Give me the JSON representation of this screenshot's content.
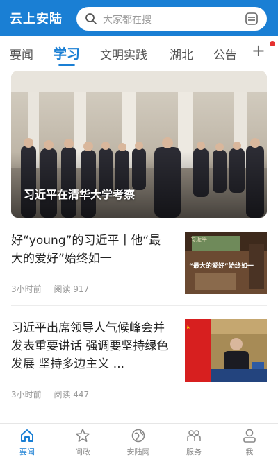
{
  "header": {
    "app_title": "云上安陆",
    "search_placeholder": "大家都在搜"
  },
  "tabs": [
    {
      "label": "要闻"
    },
    {
      "label": "学习"
    },
    {
      "label": "文明实践"
    },
    {
      "label": "湖北"
    },
    {
      "label": "公告"
    }
  ],
  "feature": {
    "title": "习近平在清华大学考察"
  },
  "news": [
    {
      "title": "好“young”的习近平丨他“最大的爱好”始终如一",
      "time": "3小时前",
      "reads": "阅读 917",
      "thumb_text": "“最大的爱好”始终如一"
    },
    {
      "title": "习近平出席领导人气候峰会并发表重要讲话 强调要坚持绿色发展 坚持多边主义 ...",
      "time": "3小时前",
      "reads": "阅读 447"
    }
  ],
  "bottom_nav": [
    {
      "label": "要闻",
      "icon": "home-icon"
    },
    {
      "label": "问政",
      "icon": "star-icon"
    },
    {
      "label": "安陆网",
      "icon": "globe-icon"
    },
    {
      "label": "服务",
      "icon": "people-icon"
    },
    {
      "label": "我",
      "icon": "user-icon"
    }
  ],
  "colors": {
    "brand": "#1a7fd4",
    "notification": "#e5302f"
  }
}
